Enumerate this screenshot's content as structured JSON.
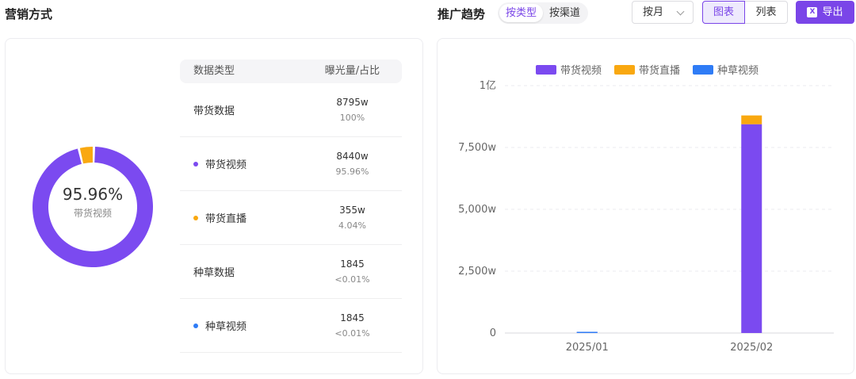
{
  "left": {
    "title": "营销方式",
    "donut": {
      "percent_text": "95.96%",
      "label": "带货视频",
      "slices": [
        {
          "name": "带货视频",
          "value": 95.96,
          "color": "#7b4af0"
        },
        {
          "name": "带货直播",
          "value": 4.04,
          "color": "#f9a810"
        },
        {
          "name": "种草视频",
          "value": 0.01,
          "color": "#2f7cf6"
        }
      ]
    },
    "table": {
      "headers": [
        "数据类型",
        "曝光量/占比"
      ],
      "rows": [
        {
          "name": "带货数据",
          "value": "8795w",
          "pct": "100%",
          "dot": ""
        },
        {
          "name": "带货视频",
          "value": "8440w",
          "pct": "95.96%",
          "dot": "#7b4af0"
        },
        {
          "name": "带货直播",
          "value": "355w",
          "pct": "4.04%",
          "dot": "#f9a810"
        },
        {
          "name": "种草数据",
          "value": "1845",
          "pct": "<0.01%",
          "dot": ""
        },
        {
          "name": "种草视频",
          "value": "1845",
          "pct": "<0.01%",
          "dot": "#2f7cf6"
        }
      ]
    }
  },
  "right": {
    "title": "推广趋势",
    "segment": {
      "options": [
        "按类型",
        "按渠道"
      ],
      "active": 0
    },
    "period_select": "按月",
    "view_toggle": {
      "options": [
        "图表",
        "列表"
      ],
      "active": 0
    },
    "export_label": "导出",
    "export_icon": "excel-icon"
  },
  "chart_data": {
    "type": "bar",
    "stacked": true,
    "categories": [
      "2025/01",
      "2025/02"
    ],
    "series": [
      {
        "name": "带货视频",
        "values": [
          0.5,
          8440
        ],
        "color": "#7b4af0"
      },
      {
        "name": "带货直播",
        "values": [
          0,
          355
        ],
        "color": "#f9a810"
      },
      {
        "name": "种草视频",
        "values": [
          0.1845,
          0
        ],
        "color": "#2f7cf6"
      }
    ],
    "ylim": [
      0,
      10000
    ],
    "y_ticks": [
      0,
      2500,
      5000,
      7500,
      10000
    ],
    "y_tick_labels": [
      "0",
      "2,500w",
      "5,000w",
      "7,500w",
      "1亿"
    ],
    "grid": true,
    "legend_position": "top-center"
  }
}
